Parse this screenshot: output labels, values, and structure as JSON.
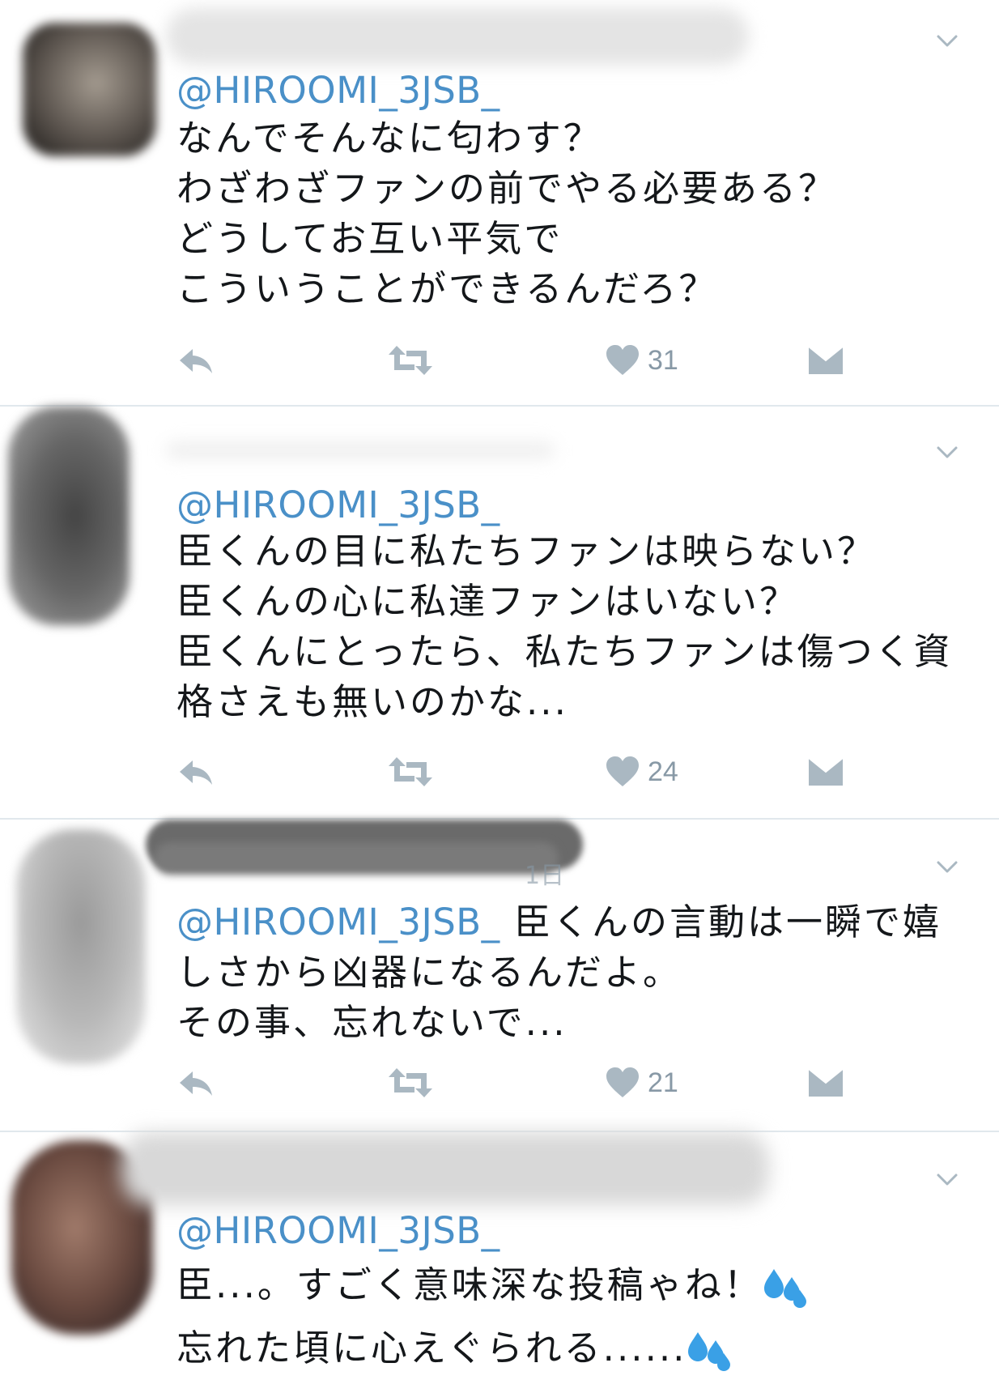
{
  "tweets": [
    {
      "handle": "@HIROOMI_3JSB_",
      "lines": [
        "なんでそんなに匂わす？",
        "わざわざファンの前でやる必要ある？",
        "どうしてお互い平気で",
        "こういうことができるんだろ？"
      ],
      "like_count": "31"
    },
    {
      "handle": "@HIROOMI_3JSB_",
      "lines": [
        "臣くんの目に私たちファンは映らない？",
        "臣くんの心に私達ファンはいない？",
        "臣くんにとったら、私たちファンは傷つく資",
        "格さえも無いのかな..."
      ],
      "like_count": "24"
    },
    {
      "handle": "@HIROOMI_3JSB_",
      "first_line_rest": " 臣くんの言動は一瞬で嬉",
      "lines": [
        "しさから凶器になるんだよ。",
        "その事、忘れないで..."
      ],
      "like_count": "21",
      "meta_partial": "1日"
    },
    {
      "handle": "@HIROOMI_3JSB_",
      "line1": "臣...。すごく意味深な投稿ゃね！",
      "line2": "忘れた頃に心えぐられる......"
    }
  ],
  "icons": {
    "reply": "reply-icon",
    "retweet": "retweet-icon",
    "like": "heart-icon",
    "dm": "envelope-icon",
    "more": "chevron-down-icon",
    "sweat": "sweat-droplets-icon"
  },
  "colors": {
    "handle": "#4a90c8",
    "text": "#14171a",
    "icon": "#aab8c2",
    "divider": "#e1e8ed"
  }
}
